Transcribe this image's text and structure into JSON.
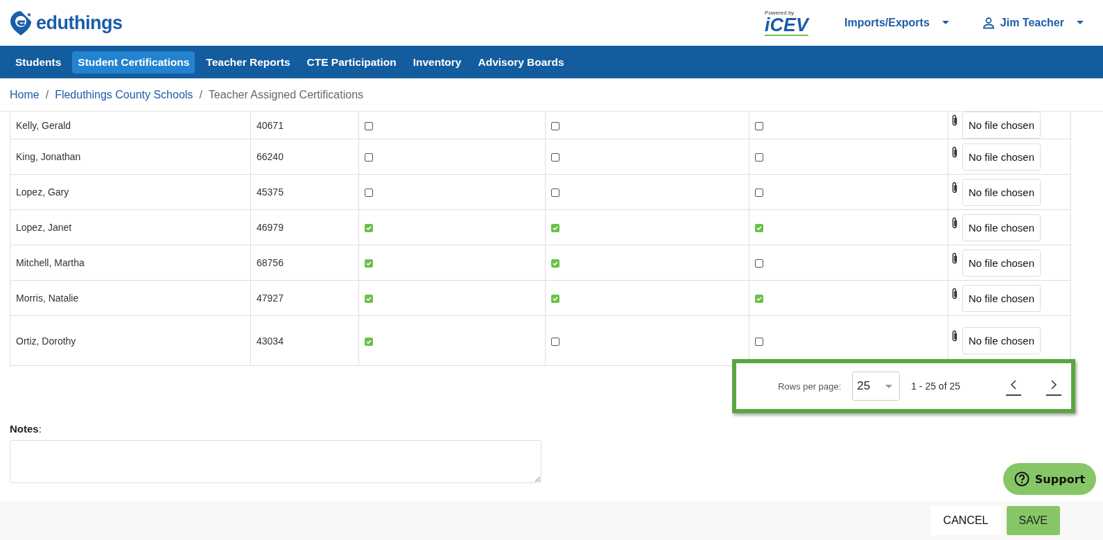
{
  "header": {
    "logo_text": "eduthings",
    "powered_by": "Powered by",
    "partner_logo": "iCEV",
    "menus": [
      {
        "label": "Imports/Exports",
        "kind": "menu"
      },
      {
        "label": "Jim Teacher",
        "kind": "user"
      }
    ]
  },
  "nav": [
    {
      "label": "Students",
      "selected": false
    },
    {
      "label": "Student Certifications",
      "selected": true
    },
    {
      "label": "Teacher Reports",
      "selected": false
    },
    {
      "label": "CTE Participation",
      "selected": false
    },
    {
      "label": "Inventory",
      "selected": false
    },
    {
      "label": "Advisory Boards",
      "selected": false
    }
  ],
  "breadcrumb": {
    "separator": "/",
    "items": [
      "Home",
      "Fleduthings County Schools",
      "Teacher Assigned Certifications"
    ]
  },
  "table": {
    "rows": [
      {
        "name": "Kelly, Gerald",
        "id": "40671",
        "checks": [
          false,
          false,
          false
        ],
        "file": "No file chosen"
      },
      {
        "name": "King, Jonathan",
        "id": "66240",
        "checks": [
          false,
          false,
          false
        ],
        "file": "No file chosen"
      },
      {
        "name": "Lopez, Gary",
        "id": "45375",
        "checks": [
          false,
          false,
          false
        ],
        "file": "No file chosen"
      },
      {
        "name": "Lopez, Janet",
        "id": "46979",
        "checks": [
          true,
          true,
          true
        ],
        "file": "No file chosen"
      },
      {
        "name": "Mitchell, Martha",
        "id": "68756",
        "checks": [
          true,
          true,
          false
        ],
        "file": "No file chosen"
      },
      {
        "name": "Morris, Natalie",
        "id": "47927",
        "checks": [
          true,
          true,
          true
        ],
        "file": "No file chosen"
      },
      {
        "name": "Ortiz, Dorothy",
        "id": "43034",
        "checks": [
          true,
          false,
          false
        ],
        "file": "No file chosen"
      }
    ]
  },
  "pagination": {
    "rows_per_page_label": "Rows per page:",
    "rows_per_page": "25",
    "range": "1 - 25 of 25"
  },
  "notes": {
    "label": "Notes",
    "colon": ":"
  },
  "support": "Support",
  "buttons": [
    {
      "label": "CANCEL",
      "kind": "secondary"
    },
    {
      "label": "SAVE",
      "kind": "primary"
    }
  ]
}
